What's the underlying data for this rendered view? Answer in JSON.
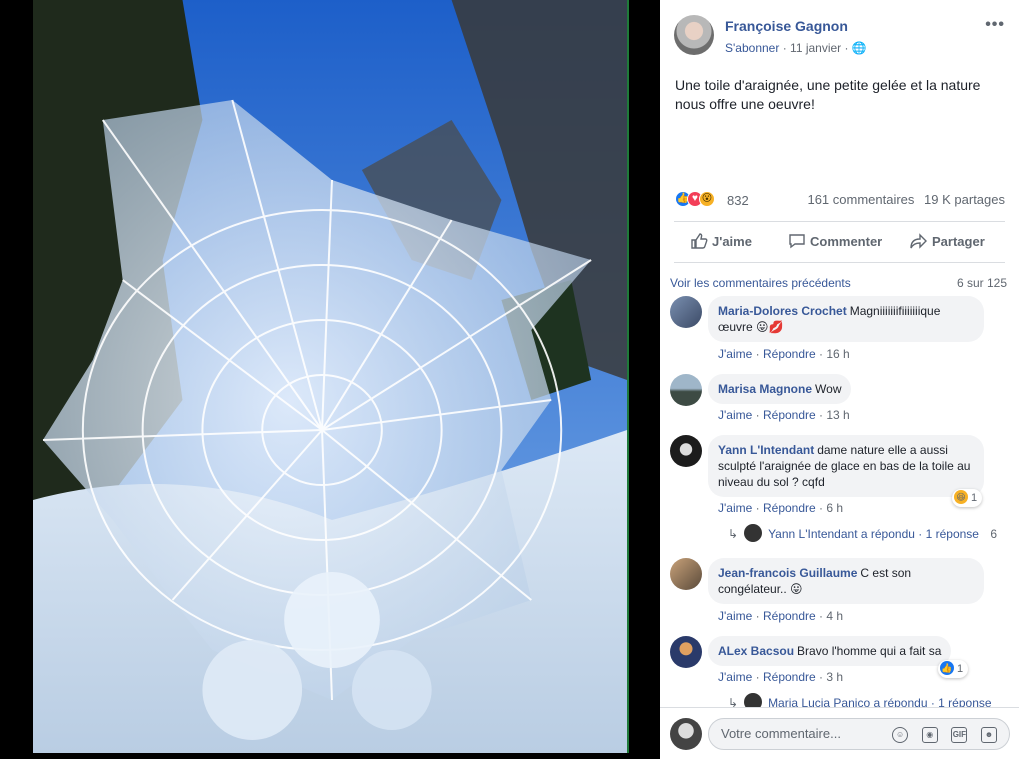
{
  "post": {
    "author": "Françoise Gagnon",
    "follow": "S'abonner",
    "date": "11 janvier",
    "privacy_icon": "globe-icon",
    "more": "•••",
    "text": "Une toile d'araignée, une petite gelée et la nature nous offre une oeuvre!",
    "reactions_count": "832",
    "comments_count": "161 commentaires",
    "shares_count": "19 K partages",
    "actions": {
      "like": "J'aime",
      "comment": "Commenter",
      "share": "Partager"
    }
  },
  "comments": {
    "prev_link": "Voir les commentaires précédents",
    "count": "6 sur 125",
    "items": [
      {
        "name": "Maria-Dolores Crochet",
        "text": "Magniiiiiiifiiiiiiique œuvre 😛💋",
        "like": "J'aime",
        "reply": "Répondre",
        "time": "16 h"
      },
      {
        "name": "Marisa Magnone",
        "text": "Wow",
        "like": "J'aime",
        "reply": "Répondre",
        "time": "13 h"
      },
      {
        "name": "Yann L'Intendant",
        "text": "dame nature elle a aussi sculpté l'araignée de glace en bas de la toile au niveau du sol ? cqfd",
        "like": "J'aime",
        "reply": "Répondre",
        "time": "6 h",
        "reaction_count": "1"
      },
      {
        "name": "Jean-francois Guillaume",
        "text": "C est son congélateur.. 😛",
        "like": "J'aime",
        "reply": "Répondre",
        "time": "4 h"
      },
      {
        "name": "ALex Bacsou",
        "text": "Bravo l'homme qui a fait sa",
        "like": "J'aime",
        "reply": "Répondre",
        "time": "3 h",
        "reaction_count": "1"
      }
    ],
    "replies": [
      {
        "who": "Yann L'Intendant a répondu",
        "count": "1 réponse",
        "extra": "6"
      },
      {
        "who": "Maria Lucia Panico a répondu",
        "count": "1 réponse"
      }
    ]
  },
  "composer": {
    "placeholder": "Votre commentaire..."
  },
  "colors": {
    "link": "#385898",
    "muted": "#606770",
    "bubble": "#f2f3f5",
    "like_blue": "#1877f2"
  }
}
